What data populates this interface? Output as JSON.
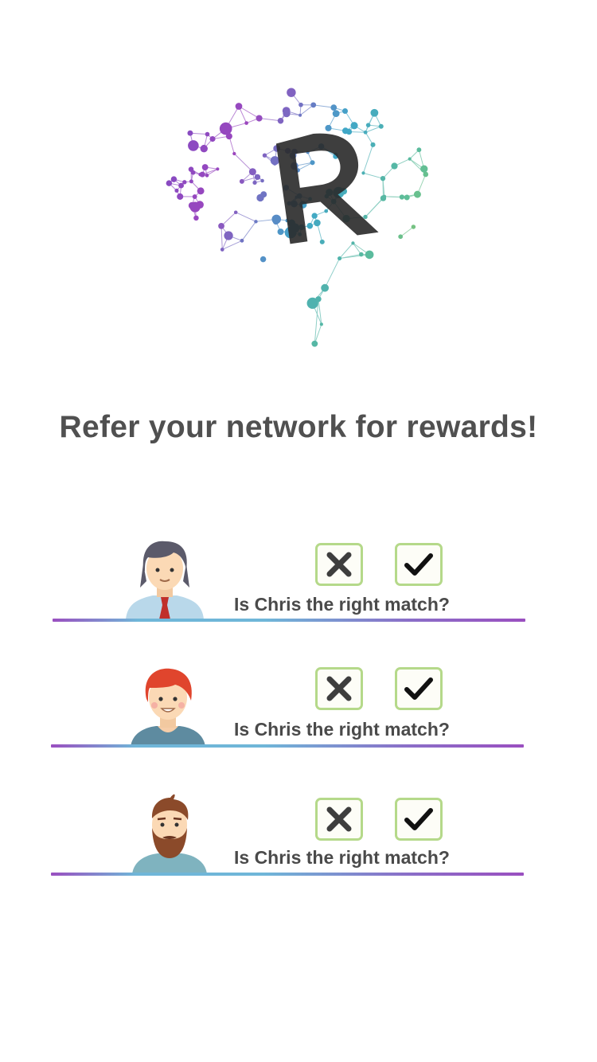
{
  "header": {
    "logo_icon": "brain-network-r-logo",
    "tagline": "Refer your network for rewards!"
  },
  "matches": [
    {
      "avatar_icon": "man-with-tie-avatar",
      "question": "Is Chris the right match?",
      "reject_icon": "x-icon",
      "accept_icon": "check-icon"
    },
    {
      "avatar_icon": "red-hair-woman-avatar",
      "question": "Is Chris the right match?",
      "reject_icon": "x-icon",
      "accept_icon": "check-icon"
    },
    {
      "avatar_icon": "bearded-man-avatar",
      "question": "Is Chris the right match?",
      "reject_icon": "x-icon",
      "accept_icon": "check-icon"
    }
  ],
  "colors": {
    "button_border": "#b5d98a",
    "divider_purple": "#9a4fc0",
    "divider_blue": "#6fb6d8",
    "text": "#4a4a4a"
  }
}
